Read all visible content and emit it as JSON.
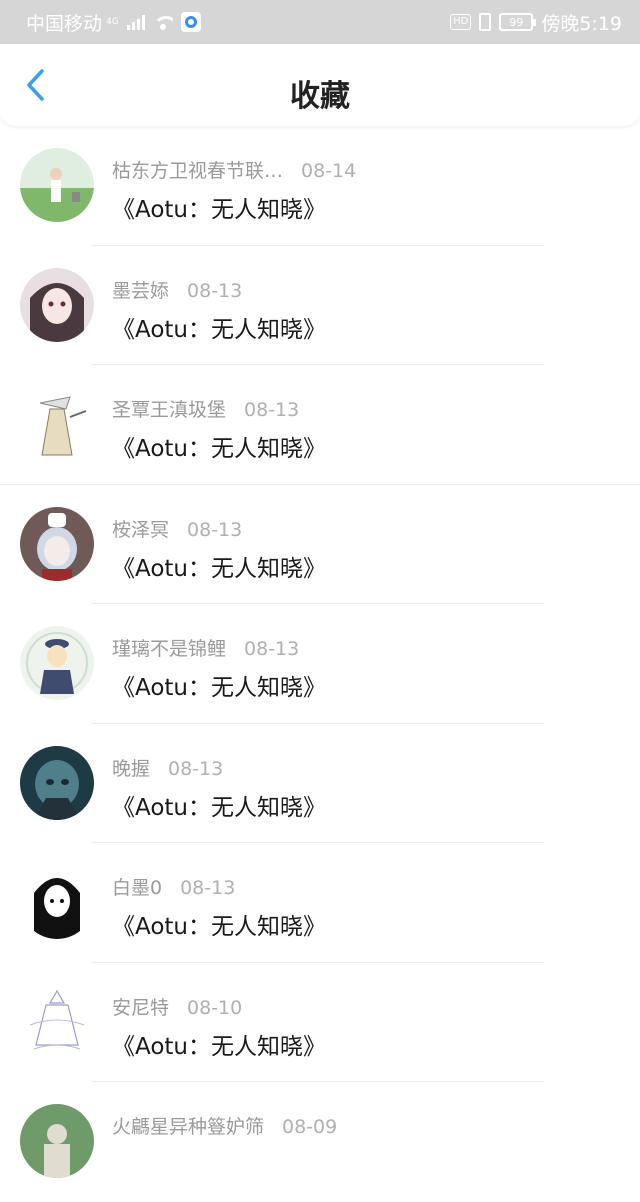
{
  "status": {
    "carrier": "中国移动",
    "network": "4G",
    "battery": "99",
    "time": "傍晚5:19",
    "hd_label": "HD"
  },
  "nav": {
    "title": "收藏",
    "back_icon": "chevron-left-icon",
    "accent": "#3a9ef5"
  },
  "items": [
    {
      "author": "枯东方卫视春节联…",
      "date": "08-14",
      "title": "《Aotu：无人知晓》",
      "avatar_colors": [
        "#7fb86a",
        "#e8efe0"
      ]
    },
    {
      "author": "墨芸婖",
      "date": "08-13",
      "title": "《Aotu：无人知晓》",
      "avatar_colors": [
        "#4a3a3f",
        "#e9d8dc"
      ]
    },
    {
      "author": "圣覃王滇圾堡",
      "date": "08-13",
      "title": "《Aotu：无人知晓》",
      "avatar_colors": [
        "#ffffff",
        "#d9ccb0"
      ]
    },
    {
      "author": "桉泽冥",
      "date": "08-13",
      "title": "《Aotu：无人知晓》",
      "avatar_colors": [
        "#6f5a58",
        "#cfd8e6"
      ]
    },
    {
      "author": "瑾璃不是锦鲤",
      "date": "08-13",
      "title": "《Aotu：无人知晓》",
      "avatar_colors": [
        "#eef3ee",
        "#3f4c70"
      ]
    },
    {
      "author": "晚握",
      "date": "08-13",
      "title": "《Aotu：无人知晓》",
      "avatar_colors": [
        "#1e3a44",
        "#4f7f8a"
      ]
    },
    {
      "author": "白墨0",
      "date": "08-13",
      "title": "《Aotu：无人知晓》",
      "avatar_colors": [
        "#ffffff",
        "#111111"
      ]
    },
    {
      "author": "安尼特",
      "date": "08-10",
      "title": "《Aotu：无人知晓》",
      "avatar_colors": [
        "#ffffff",
        "#9a9ad0"
      ]
    },
    {
      "author": "火騗星异种簦妒筛",
      "date": "08-09",
      "title": "",
      "avatar_colors": [
        "#6f9a6a",
        "#e0ddd0"
      ]
    }
  ]
}
